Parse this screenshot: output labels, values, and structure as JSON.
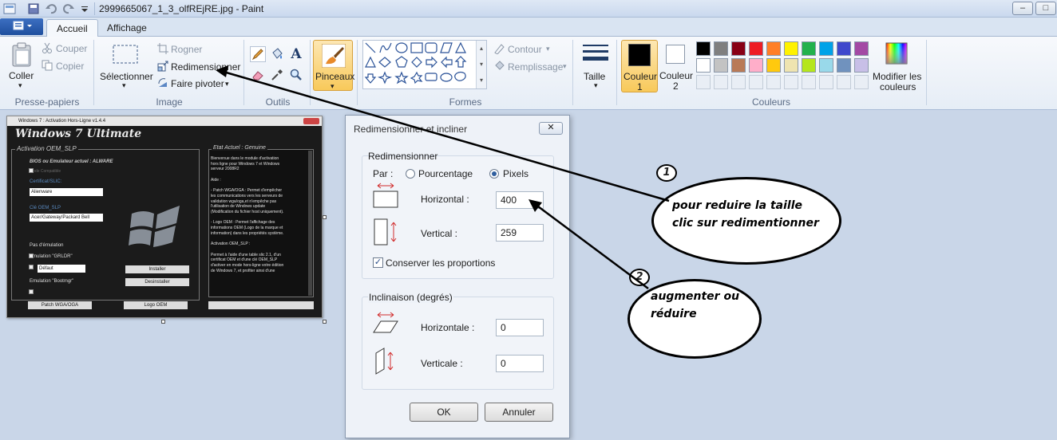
{
  "window": {
    "title": "2999665067_1_3_olfREjRE.jpg - Paint",
    "minimize": "–",
    "maximize": "□"
  },
  "tabs": [
    "Accueil",
    "Affichage"
  ],
  "ribbon": {
    "clipboard": {
      "paste": "Coller",
      "cut": "Couper",
      "copy": "Copier",
      "label": "Presse-papiers"
    },
    "image": {
      "select": "Sélectionner",
      "crop": "Rogner",
      "resize": "Redimensionner",
      "rotate": "Faire pivoter",
      "label": "Image"
    },
    "tools": {
      "label": "Outils"
    },
    "brushes": {
      "label": "Pinceaux"
    },
    "shapes": {
      "outline": "Contour",
      "fill": "Remplissage",
      "label": "Formes"
    },
    "size": {
      "label": "Taille"
    },
    "colors": {
      "color1": "Couleur",
      "color1_num": "1",
      "color2": "Couleur",
      "color2_num": "2",
      "edit": "Modifier les",
      "edit2": "couleurs",
      "label": "Couleurs",
      "palette_row1": [
        "#000000",
        "#7f7f7f",
        "#880015",
        "#ed1c24",
        "#ff7f27",
        "#fff200",
        "#22b14c",
        "#00a2e8",
        "#3f48cc",
        "#a349a4"
      ],
      "palette_row2": [
        "#ffffff",
        "#c3c3c3",
        "#b97a57",
        "#ffaec9",
        "#ffc90e",
        "#efe4b0",
        "#b5e61d",
        "#99d9ea",
        "#7092be",
        "#c8bfe7"
      ]
    }
  },
  "canvas_image": {
    "window_title": "Windows 7 : Activation Hors-Ligne v1.4.4",
    "heading": "Windows 7 Ultimate",
    "sub": "Activation OEM_SLP",
    "bios": "BIOS ou Emulateur actuel : ALWARE",
    "mode": "Mode Compatible",
    "cert": "Certificat/SLIC:",
    "cert_val": "Alienware",
    "key": "Clé OEM_SLP",
    "key_val": "Acer/Gateway/Packard Bell",
    "no_emu": "Pas d'émulation",
    "emu_grldr": "Emulation \"GRLDR\"",
    "default": "Défaut",
    "emu_boot": "Emulation \"Bootmgr\"",
    "install": "Installer",
    "uninstall": "Desinstaller",
    "patch": "Patch WGA/OGA",
    "logo": "Logo OEM",
    "state": "Etat Actuel : Genuine",
    "desc": [
      "Bienvenue dans le module d'activation",
      "hors ligne pour Windows 7 et Windows",
      "serveur 2008R2",
      "",
      "Aide :",
      "",
      "- Patch WGA/OGA : Permet d'empêcher",
      "les communications vers les serveurs de",
      "validation wga/oga,et n'empêche pas",
      "l'utilisation de Windows update",
      "(Modification du fichier host uniquement).",
      "",
      "- Logo OEM : Permet l'affichage des",
      "informations OEM (Logo de la marque et",
      "information) dans les propriétés système.",
      "",
      "Activation OEM_SLP :",
      "",
      "Permet à l'aide d'une table slic 2.1, d'un",
      "certificat OEM et d'une clé OEM_SLP",
      "d'activer en mode hors-ligne votre édition",
      "de Windows 7, et profiter ainsi d'une"
    ]
  },
  "dialog": {
    "title": "Redimensionner et incliner",
    "close": "✕",
    "resize_group": "Redimensionner",
    "by": "Par :",
    "percent": "Pourcentage",
    "pixels": "Pixels",
    "horizontal": "Horizontal :",
    "horizontal_val": "400",
    "vertical": "Vertical :",
    "vertical_val": "259",
    "keep_ratio": "Conserver les proportions",
    "skew_group": "Inclinaison (degrés)",
    "skew_h": "Horizontale :",
    "skew_h_val": "0",
    "skew_v": "Verticale :",
    "skew_v_val": "0",
    "ok": "OK",
    "cancel": "Annuler"
  },
  "annotations": {
    "n1": "1",
    "note1_line1": "pour reduire la taille",
    "note1_line2": "clic sur redimentionner",
    "n2": "2",
    "note2_line1": "augmenter ou",
    "note2_line2": "réduire"
  }
}
